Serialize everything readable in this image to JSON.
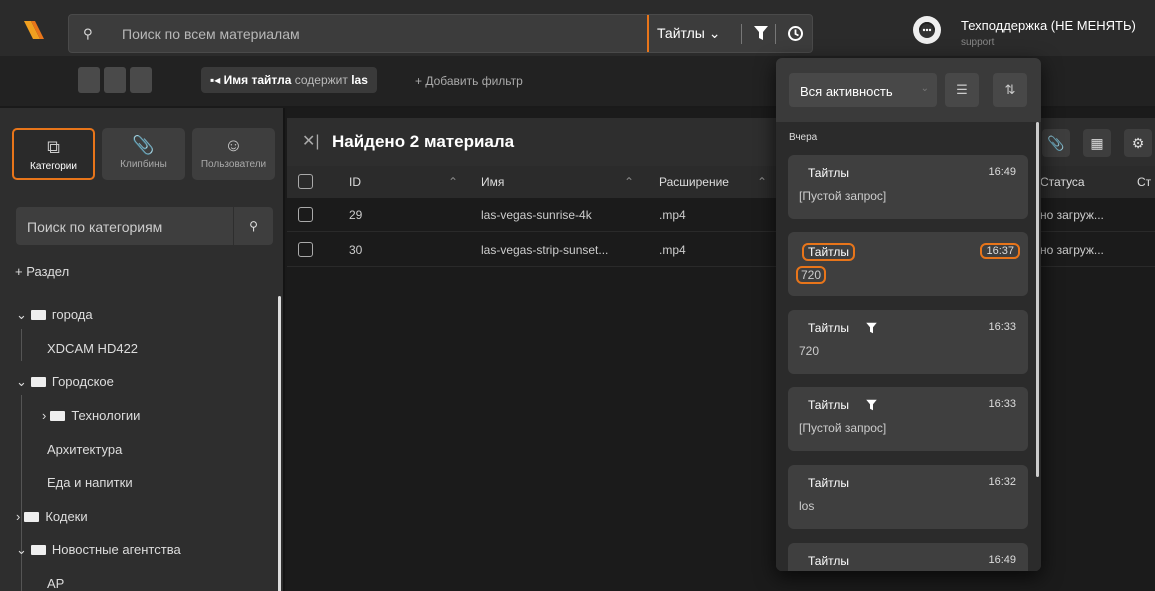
{
  "header": {
    "search_placeholder": "Поиск по всем материалам",
    "search_type": "Тайтлы",
    "support_name": "Техподдержка (НЕ МЕНЯТЬ)",
    "support_sub": "support"
  },
  "toolbar": {
    "filter_chip": {
      "field": "Имя тайтла",
      "op": "содержит",
      "value": "las"
    },
    "add_filter": "+ Добавить фильтр"
  },
  "sidebar": {
    "tabs": [
      {
        "label": "Категории",
        "icon": "categories-icon",
        "active": true
      },
      {
        "label": "Клипбины",
        "icon": "paperclip-icon",
        "active": false
      },
      {
        "label": "Пользователи",
        "icon": "user-icon",
        "active": false
      }
    ],
    "search_placeholder": "Поиск по категориям",
    "add_section": "+ Раздел",
    "tree": [
      {
        "label": "города",
        "folder": "open",
        "chevron": "⌄"
      },
      {
        "label": "XDCAM HD422"
      },
      {
        "label": "Городское",
        "folder": "open",
        "chevron": "⌄"
      },
      {
        "label": "Технологии",
        "folder": "closed",
        "chevron": "›"
      },
      {
        "label": "Архитектура"
      },
      {
        "label": "Еда и напитки"
      },
      {
        "label": "Кодеки",
        "folder": "closed",
        "chevron": "›"
      },
      {
        "label": "Новостные агентства",
        "folder": "open",
        "chevron": "⌄"
      },
      {
        "label": "AP"
      }
    ]
  },
  "main": {
    "title": "Найдено 2 материала",
    "columns": [
      "ID",
      "Имя",
      "Расширение",
      "Статуса",
      "Ст"
    ],
    "rows": [
      {
        "id": "29",
        "name": "las-vegas-sunrise-4k",
        "ext": ".mp4",
        "status": "но загруж..."
      },
      {
        "id": "30",
        "name": "las-vegas-strip-sunset...",
        "ext": ".mp4",
        "status": "но загруж..."
      }
    ]
  },
  "history_popup": {
    "filter_label": "Вся активность",
    "day_label": "Вчера",
    "entries": [
      {
        "title": "Тайтлы",
        "time": "16:49",
        "query": "[Пустой запрос]",
        "filter": false,
        "highlight": false
      },
      {
        "title": "Тайтлы",
        "time": "16:37",
        "query": "720",
        "filter": false,
        "highlight": true
      },
      {
        "title": "Тайтлы",
        "time": "16:33",
        "query": "720",
        "filter": true,
        "highlight": false
      },
      {
        "title": "Тайтлы",
        "time": "16:33",
        "query": "[Пустой запрос]",
        "filter": true,
        "highlight": false
      },
      {
        "title": "Тайтлы",
        "time": "16:32",
        "query": "los",
        "filter": false,
        "highlight": false
      },
      {
        "title": "Тайтлы",
        "time": "16:49",
        "query": "",
        "filter": false,
        "highlight": false
      }
    ]
  },
  "colors": {
    "accent": "#e8751a",
    "panel": "#2e2e2e",
    "background": "#1b1b1b"
  }
}
